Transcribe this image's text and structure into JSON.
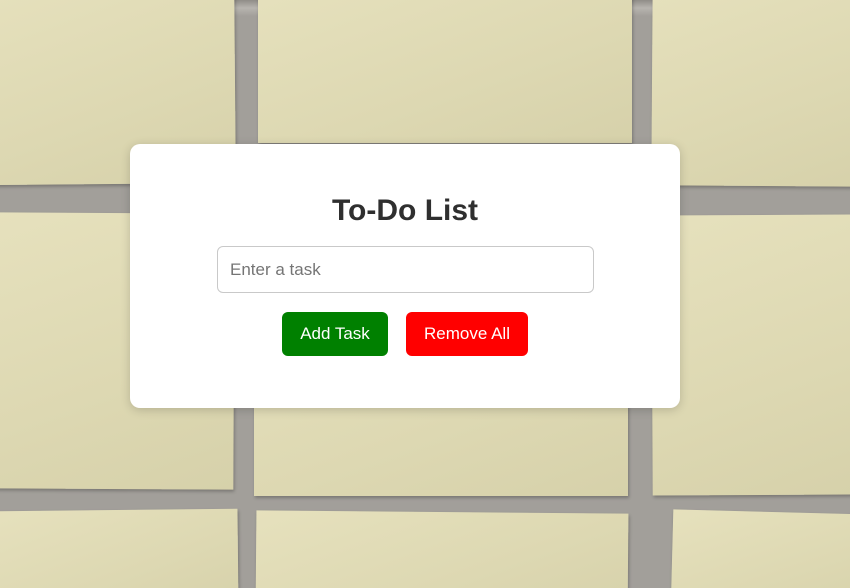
{
  "app": {
    "title": "To-Do List"
  },
  "task_input": {
    "value": "",
    "placeholder": "Enter a task"
  },
  "buttons": {
    "add_label": "Add Task",
    "remove_label": "Remove All"
  },
  "colors": {
    "add_button": "#008000",
    "remove_button": "#ff0000",
    "card_background": "#ffffff",
    "title_text": "#2f2f2f"
  }
}
